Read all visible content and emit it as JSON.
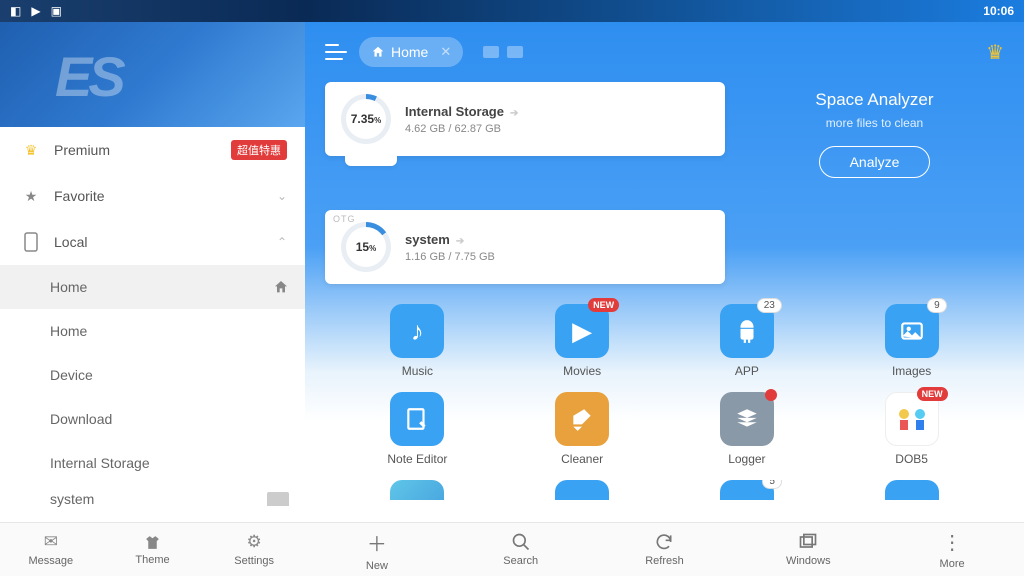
{
  "statusbar": {
    "time": "10:06"
  },
  "sidebar": {
    "premium": {
      "label": "Premium",
      "badge": "超值特惠"
    },
    "favorite": {
      "label": "Favorite"
    },
    "local": {
      "label": "Local",
      "items": [
        "Home",
        "Home",
        "Device",
        "Download",
        "Internal Storage",
        "system"
      ]
    },
    "bottom": {
      "message": "Message",
      "theme": "Theme",
      "settings": "Settings"
    }
  },
  "topbar": {
    "location": "Home"
  },
  "storage": [
    {
      "name": "Internal Storage",
      "percent": "7.35",
      "used": "4.62 GB",
      "total": "62.87 GB"
    },
    {
      "name": "system",
      "percent": "15",
      "used": "1.16 GB",
      "total": "7.75 GB",
      "otg": "OTG"
    }
  ],
  "analyzer": {
    "title": "Space Analyzer",
    "subtitle": "more files to clean",
    "button": "Analyze"
  },
  "categories": [
    {
      "label": "Music",
      "color": "c-blue",
      "badge": null
    },
    {
      "label": "Movies",
      "color": "c-blue",
      "badge": "NEW"
    },
    {
      "label": "APP",
      "color": "c-blue",
      "badge_num": "23"
    },
    {
      "label": "Images",
      "color": "c-blue",
      "badge_num": "9"
    },
    {
      "label": "Note Editor",
      "color": "c-blue",
      "badge": null
    },
    {
      "label": "Cleaner",
      "color": "c-orange",
      "badge": null
    },
    {
      "label": "Logger",
      "color": "c-gray",
      "badge_dot": true
    },
    {
      "label": "DOB5",
      "color": "c-white",
      "badge": "NEW"
    }
  ],
  "cutoff": [
    {
      "color": "c-peek"
    },
    {
      "color": "c-blue"
    },
    {
      "color": "c-blue",
      "badge_num": "5"
    },
    {
      "color": "c-blue"
    }
  ],
  "bottom": {
    "new": "New",
    "search": "Search",
    "refresh": "Refresh",
    "windows": "Windows",
    "more": "More"
  }
}
